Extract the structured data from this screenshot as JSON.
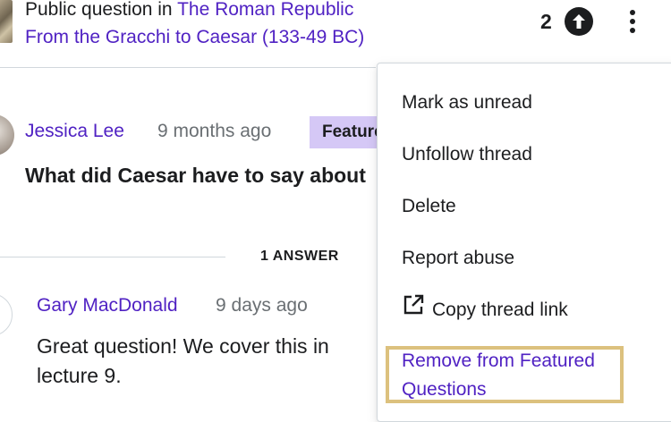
{
  "header": {
    "prefix": "Public question in ",
    "course": "The Roman Republic",
    "lecture": "From the Gracchi to Caesar (133-49 BC)",
    "upvotes": "2"
  },
  "question": {
    "author": "Jessica Lee",
    "time": "9 months ago",
    "badge": "Featured",
    "title": "What did Caesar have to say about"
  },
  "answers": {
    "count_label": "1 ANSWER",
    "items": [
      {
        "author": "Gary MacDonald",
        "time": "9 days ago",
        "body": "Great question! We cover this in lecture 9."
      }
    ]
  },
  "menu": {
    "items": [
      "Mark as unread",
      "Unfollow thread",
      "Delete",
      "Report abuse",
      "Copy thread link",
      "Remove from Featured Questions"
    ]
  },
  "colors": {
    "link": "#5022c3",
    "badge_bg": "#d5c8f6",
    "highlight": "#dcc17e",
    "text": "#1c1d1f",
    "muted": "#6a6f73"
  },
  "icons": [
    "upvote-arrow-icon",
    "kebab-menu-icon",
    "external-link-icon"
  ]
}
